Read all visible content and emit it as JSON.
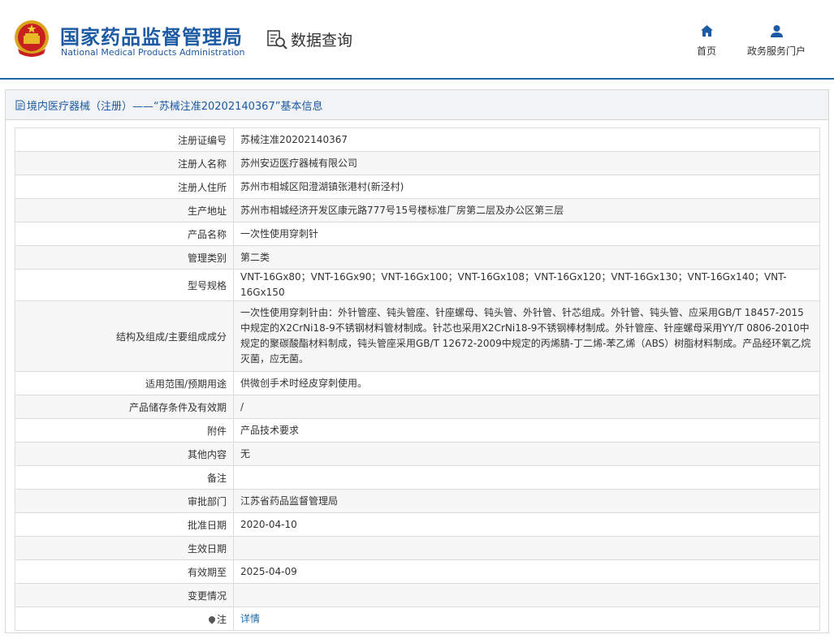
{
  "header": {
    "brand_cn": "国家药品监督管理局",
    "brand_en": "National Medical Products Administration",
    "query_label": "数据查询",
    "nav": {
      "home": "首页",
      "portal": "政务服务门户"
    },
    "accent_color": "#1c5aa3"
  },
  "panel": {
    "title": "境内医疗器械（注册）——“苏械注准20202140367”基本信息"
  },
  "rows": [
    {
      "label": "注册证编号",
      "value": "苏械注准20202140367"
    },
    {
      "label": "注册人名称",
      "value": "苏州安迈医疗器械有限公司"
    },
    {
      "label": "注册人住所",
      "value": "苏州市相城区阳澄湖镇张港村(新泾村)"
    },
    {
      "label": "生产地址",
      "value": "苏州市相城经济开发区康元路777号15号楼标准厂房第二层及办公区第三层"
    },
    {
      "label": "产品名称",
      "value": "一次性使用穿刺针"
    },
    {
      "label": "管理类别",
      "value": "第二类"
    },
    {
      "label": "型号规格",
      "value": "VNT-16Gx80；VNT-16Gx90；VNT-16Gx100；VNT-16Gx108；VNT-16Gx120；VNT-16Gx130；VNT-16Gx140；VNT-16Gx150"
    },
    {
      "label": "结构及组成/主要组成成分",
      "value": "一次性使用穿刺针由：外针管座、钝头管座、针座螺母、钝头管、外针管、针芯组成。外针管、钝头管、应采用GB/T 18457-2015中规定的X2CrNi18-9不锈钢材料管材制成。针芯也采用X2CrNi18-9不锈钢棒材制成。外针管座、针座螺母采用YY/T 0806-2010中规定的聚碳酸酯材料制成，钝头管座采用GB/T 12672-2009中规定的丙烯腈-丁二烯-苯乙烯（ABS）树脂材料制成。产品经环氧乙烷灭菌，应无菌。"
    },
    {
      "label": "适用范围/预期用途",
      "value": "供微创手术时经皮穿刺使用。"
    },
    {
      "label": "产品储存条件及有效期",
      "value": "/"
    },
    {
      "label": "附件",
      "value": "产品技术要求"
    },
    {
      "label": "其他内容",
      "value": "无"
    },
    {
      "label": "备注",
      "value": ""
    },
    {
      "label": "审批部门",
      "value": "江苏省药品监督管理局"
    },
    {
      "label": "批准日期",
      "value": "2020-04-10"
    },
    {
      "label": "生效日期",
      "value": ""
    },
    {
      "label": "有效期至",
      "value": "2025-04-09"
    },
    {
      "label": "变更情况",
      "value": ""
    }
  ],
  "note": {
    "label": "注",
    "link": "详情",
    "icon": "pin-icon"
  }
}
